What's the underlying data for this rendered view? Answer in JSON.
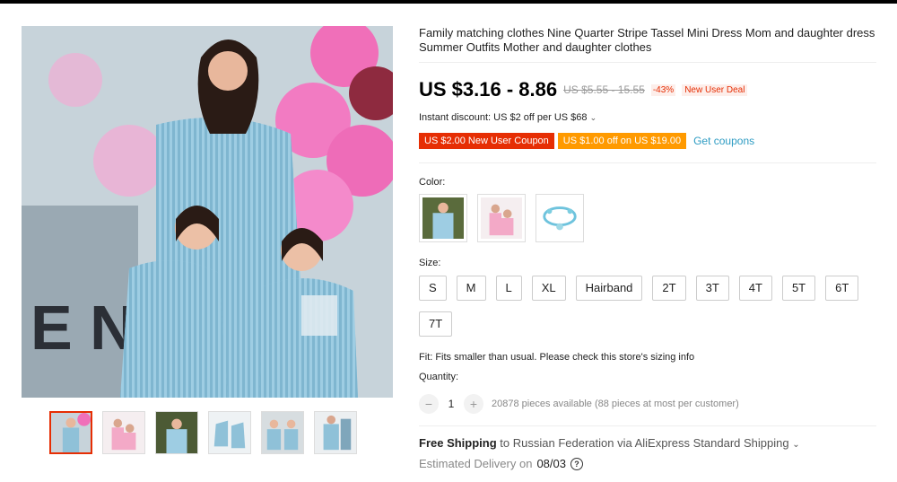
{
  "product": {
    "title": "Family matching clothes Nine Quarter Stripe Tassel Mini Dress Mom and daughter dress Summer Outfits Mother and daughter clothes",
    "price": "US $3.16 - 8.86",
    "original_price": "US $5.55 - 15.55",
    "discount": "-43%",
    "deal_badge": "New User Deal",
    "instant_discount": "Instant discount: US $2 off per US $68",
    "coupons": [
      "US $2.00 New User Coupon",
      "US $1.00 off on US $19.00"
    ],
    "get_coupons": "Get coupons",
    "color_label": "Color:",
    "size_label": "Size:",
    "sizes": [
      "S",
      "M",
      "L",
      "XL",
      "Hairband",
      "2T",
      "3T",
      "4T",
      "5T",
      "6T",
      "7T"
    ],
    "fit_note": "Fit: Fits smaller than usual. Please check this store's sizing info",
    "quantity_label": "Quantity:",
    "quantity_value": "1",
    "availability": "20878 pieces available (88 pieces at most per customer)",
    "shipping_bold": "Free Shipping",
    "shipping_rest": "to Russian Federation via AliExpress Standard Shipping",
    "delivery_label": "Estimated Delivery on",
    "delivery_date": "08/03"
  },
  "colors": {
    "accent": "#e62e04",
    "coupon_orange": "#ff9a00",
    "link": "#2e9cc3"
  }
}
